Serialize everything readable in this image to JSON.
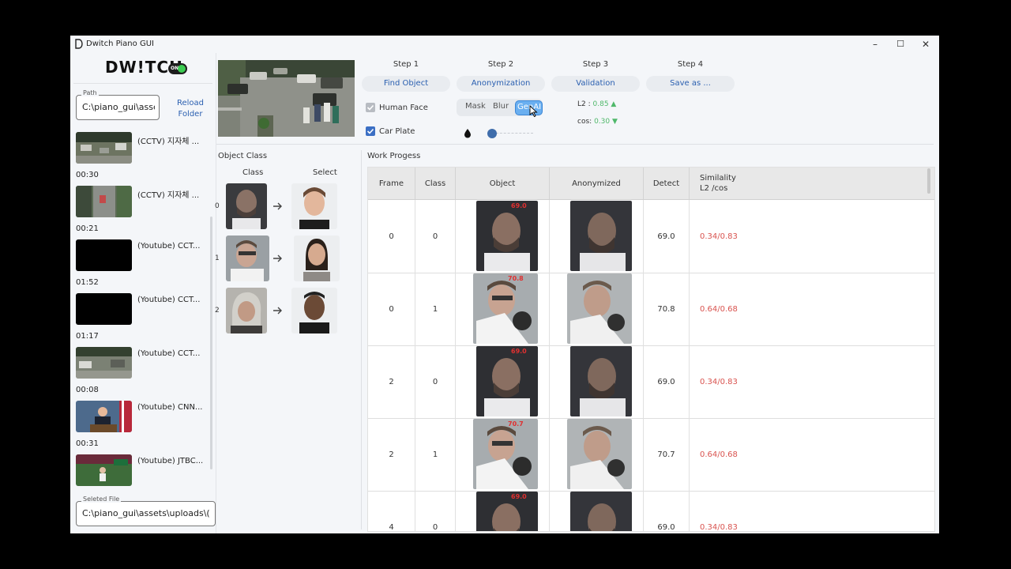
{
  "window": {
    "title": "Dwitch Piano GUI",
    "controls": [
      "–",
      "☐",
      "✕"
    ]
  },
  "logo": {
    "wordmark": "DW!TCH",
    "badge": "ON"
  },
  "path_field": {
    "label": "Path",
    "value": "C:\\piano_gui\\assets"
  },
  "reload_label": [
    "Reload",
    "Folder"
  ],
  "videos": [
    {
      "name": "(CCTV) 지자체 ...",
      "duration": "00:30",
      "thumb": "parking"
    },
    {
      "name": "(CCTV) 지자체 ...",
      "duration": "00:21",
      "thumb": "street"
    },
    {
      "name": "(Youtube) CCT...",
      "duration": "01:52",
      "thumb": "black"
    },
    {
      "name": "(Youtube) CCT...",
      "duration": "01:17",
      "thumb": "black"
    },
    {
      "name": "(Youtube) CCT...",
      "duration": "00:08",
      "thumb": "parking"
    },
    {
      "name": "(Youtube) CNN...",
      "duration": "00:31",
      "thumb": "press"
    },
    {
      "name": "(Youtube) JTBC...",
      "duration": "",
      "thumb": "sports"
    }
  ],
  "selected_file": {
    "label": "Seleted File",
    "value": "C:\\piano_gui\\assets\\uploads\\("
  },
  "steps": [
    {
      "label": "Step 1",
      "button": "Find Object"
    },
    {
      "label": "Step 2",
      "button": "Anonymization"
    },
    {
      "label": "Step 3",
      "button": "Validation"
    },
    {
      "label": "Step 4",
      "button": "Save as ..."
    }
  ],
  "options": {
    "human_face": "Human Face",
    "car_plate": "Car Plate"
  },
  "modes": {
    "mask": "Mask",
    "blur": "Blur",
    "genai": "GenAI",
    "selected": "GenAI"
  },
  "slider_level": 0.0,
  "metrics": {
    "l2_label": "L2 :",
    "l2_value": "0.85 ▲",
    "cos_label": "cos:",
    "cos_value": "0.30 ▼"
  },
  "object_class": {
    "title": "Object Class",
    "col_class": "Class",
    "col_select": "Select",
    "rows": [
      {
        "index": "0"
      },
      {
        "index": "1"
      },
      {
        "index": "2"
      }
    ]
  },
  "work": {
    "title": "Work Progess",
    "headers": {
      "frame": "Frame",
      "class": "Class",
      "object": "Object",
      "anonymized": "Anonymized",
      "detect": "Detect",
      "sim1": "Similality",
      "sim2": "L2 /cos"
    },
    "rows": [
      {
        "frame": "0",
        "class": "0",
        "detect": "69.0",
        "sim": "0.34/0.83",
        "score": "69.0"
      },
      {
        "frame": "0",
        "class": "1",
        "detect": "70.8",
        "sim": "0.64/0.68",
        "score": "70.8"
      },
      {
        "frame": "2",
        "class": "0",
        "detect": "69.0",
        "sim": "0.34/0.83",
        "score": "69.0"
      },
      {
        "frame": "2",
        "class": "1",
        "detect": "70.7",
        "sim": "0.64/0.68",
        "score": "70.7"
      },
      {
        "frame": "4",
        "class": "0",
        "detect": "69.0",
        "sim": "0.34/0.83",
        "score": "69.0"
      }
    ]
  },
  "colors": {
    "accent": "#2a5fb0",
    "check": "#3b6fc4",
    "positive": "#4fb86a",
    "similarity": "#d9534f",
    "active_mode": "#6aaff0"
  }
}
